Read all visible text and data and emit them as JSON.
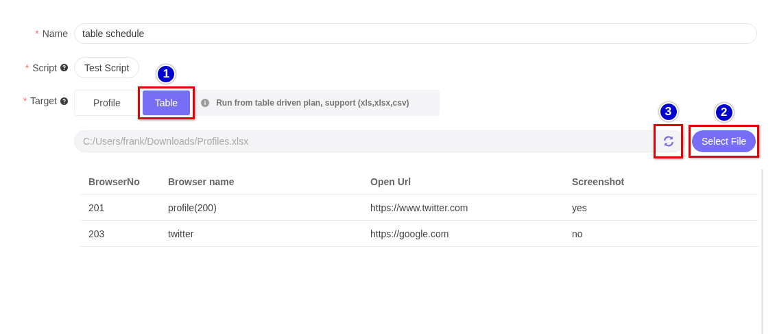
{
  "form": {
    "name": {
      "marker": "*",
      "label": "Name",
      "value": "table schedule"
    },
    "script": {
      "marker": "*",
      "label": "Script",
      "help": true,
      "value": "Test Script"
    },
    "target": {
      "marker": "*",
      "label": "Target",
      "help": true,
      "options": [
        {
          "label": "Profile",
          "selected": false
        },
        {
          "label": "Table",
          "selected": true,
          "callout": "1"
        }
      ],
      "hint": "Run from table driven plan, support (xls,xlsx,csv)"
    },
    "file": {
      "value": "C:/Users/frank/Downloads/Profiles.xlsx",
      "refresh_callout": "3"
    },
    "select_button": {
      "label": "Select File",
      "callout": "2"
    }
  },
  "table": {
    "columns": [
      "BrowserNo",
      "Browser name",
      "Open Url",
      "Screenshot"
    ],
    "rows": [
      [
        "201",
        "profile(200)",
        "https://www.twitter.com",
        "yes"
      ],
      [
        "203",
        "twitter",
        "https://google.com",
        "no"
      ]
    ]
  }
}
